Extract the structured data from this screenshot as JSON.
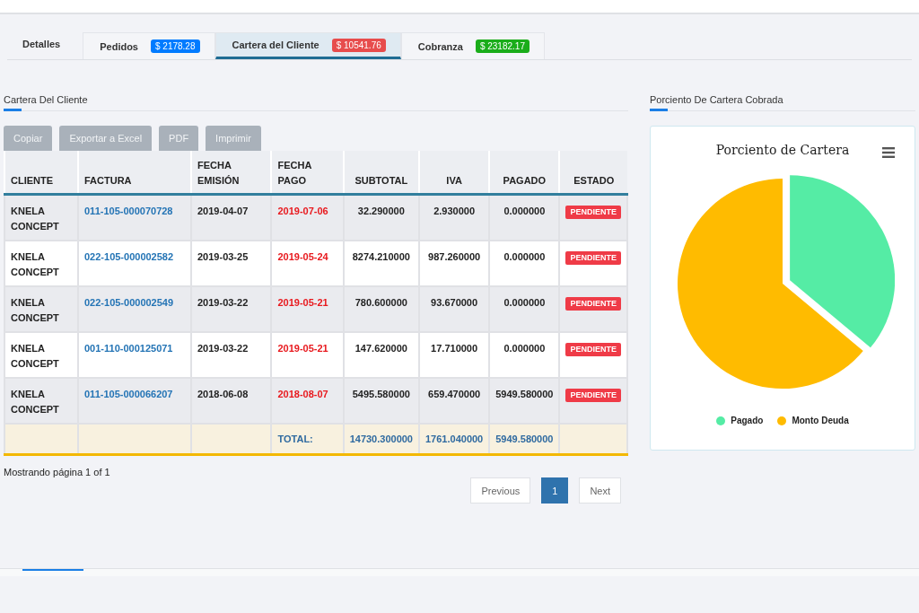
{
  "tabs": [
    {
      "label": "Detalles",
      "selected": false
    },
    {
      "label": "Pedidos",
      "badge": "$ 2178.28",
      "color": "#007bff",
      "selected": false
    },
    {
      "label": "Cartera del Cliente",
      "badge": "$ 10541.76",
      "color": "#e74c4c",
      "selected": true
    },
    {
      "label": "Cobranza",
      "badge": "$ 23182.17",
      "color": "#1aad1a",
      "selected": false
    }
  ],
  "left_section": {
    "title": "Cartera Del Cliente",
    "buttons": [
      "Copiar",
      "Exportar a Excel",
      "PDF",
      "Imprimir"
    ],
    "table": {
      "columns": [
        "CLIENTE",
        "FACTURA",
        "FECHA EMISIÓN",
        "FECHA PAGO",
        "SUBTOTAL",
        "IVA",
        "PAGADO",
        "ESTADO"
      ],
      "rows": [
        {
          "cliente": "KNELA CONCEPT",
          "factura": "011-105-000070728",
          "emision": "2019-04-07",
          "pago": "2019-07-06",
          "subtotal": "32.290000",
          "iva": "2.930000",
          "pagado": "0.000000",
          "estado": "PENDIENTE"
        },
        {
          "cliente": "KNELA CONCEPT",
          "factura": "022-105-000002582",
          "emision": "2019-03-25",
          "pago": "2019-05-24",
          "subtotal": "8274.210000",
          "iva": "987.260000",
          "pagado": "0.000000",
          "estado": "PENDIENTE"
        },
        {
          "cliente": "KNELA CONCEPT",
          "factura": "022-105-000002549",
          "emision": "2019-03-22",
          "pago": "2019-05-21",
          "subtotal": "780.600000",
          "iva": "93.670000",
          "pagado": "0.000000",
          "estado": "PENDIENTE"
        },
        {
          "cliente": "KNELA CONCEPT",
          "factura": "001-110-000125071",
          "emision": "2019-03-22",
          "pago": "2019-05-21",
          "subtotal": "147.620000",
          "iva": "17.710000",
          "pagado": "0.000000",
          "estado": "PENDIENTE"
        },
        {
          "cliente": "KNELA CONCEPT",
          "factura": "011-105-000066207",
          "emision": "2018-06-08",
          "pago": "2018-08-07",
          "subtotal": "5495.580000",
          "iva": "659.470000",
          "pagado": "5949.580000",
          "estado": "PENDIENTE"
        }
      ],
      "totals": {
        "label": "TOTAL:",
        "subtotal": "14730.300000",
        "iva": "1761.040000",
        "pagado": "5949.580000"
      }
    },
    "info": "Mostrando página 1 of 1",
    "pagination": [
      {
        "label": "Previous",
        "selected": false
      },
      {
        "label": "1",
        "selected": true
      },
      {
        "label": "Next",
        "selected": false
      }
    ]
  },
  "right_section": {
    "title": "Porciento De Cartera Cobrada",
    "chart_data": {
      "type": "pie",
      "title": "Porciento de Cartera",
      "categories": [
        "Pagado",
        "Monto Deuda"
      ],
      "values": [
        36.08,
        63.92
      ],
      "colors": [
        "#55eca5",
        "#ffbb00"
      ],
      "legend": "bottom"
    }
  }
}
